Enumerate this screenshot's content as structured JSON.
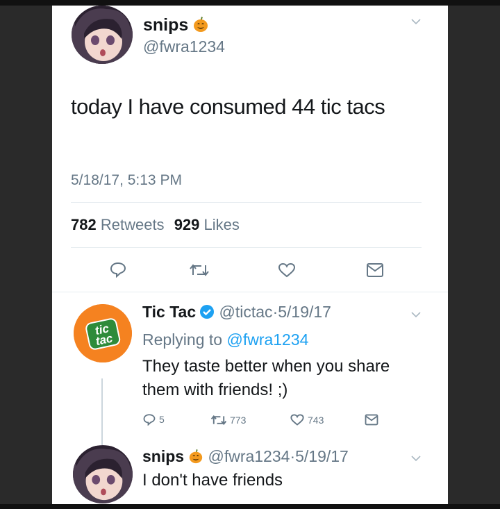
{
  "original_tweet": {
    "display_name": "snips",
    "handle": "@fwra1234",
    "text": "today I have consumed 44 tic tacs",
    "timestamp": "5/18/17, 5:13 PM",
    "retweets_count": "782",
    "retweets_label": "Retweets",
    "likes_count": "929",
    "likes_label": "Likes"
  },
  "reply_tweet": {
    "display_name": "Tic Tac",
    "handle": "@tictac",
    "date": "5/19/17",
    "replying_prefix": "Replying to",
    "replying_to": "@fwra1234",
    "text": "They taste better when you share them with friends! ;)",
    "replies_count": "5",
    "retweets_count": "773",
    "likes_count": "743",
    "avatar_logo_line1": "tic",
    "avatar_logo_line2": "tac",
    "brand_color": "#f58220"
  },
  "last_reply": {
    "display_name": "snips",
    "handle": "@fwra1234",
    "date": "5/19/17",
    "text": "I don't have friends"
  },
  "separator": "·",
  "icons": [
    "chevron-down-icon",
    "pumpkin-emoji-icon",
    "verified-badge-icon",
    "reply-icon",
    "retweet-icon",
    "like-icon",
    "dm-icon"
  ],
  "colors": {
    "link": "#1da1f2",
    "muted": "#657786",
    "text": "#14171a",
    "verified": "#1da1f2"
  }
}
